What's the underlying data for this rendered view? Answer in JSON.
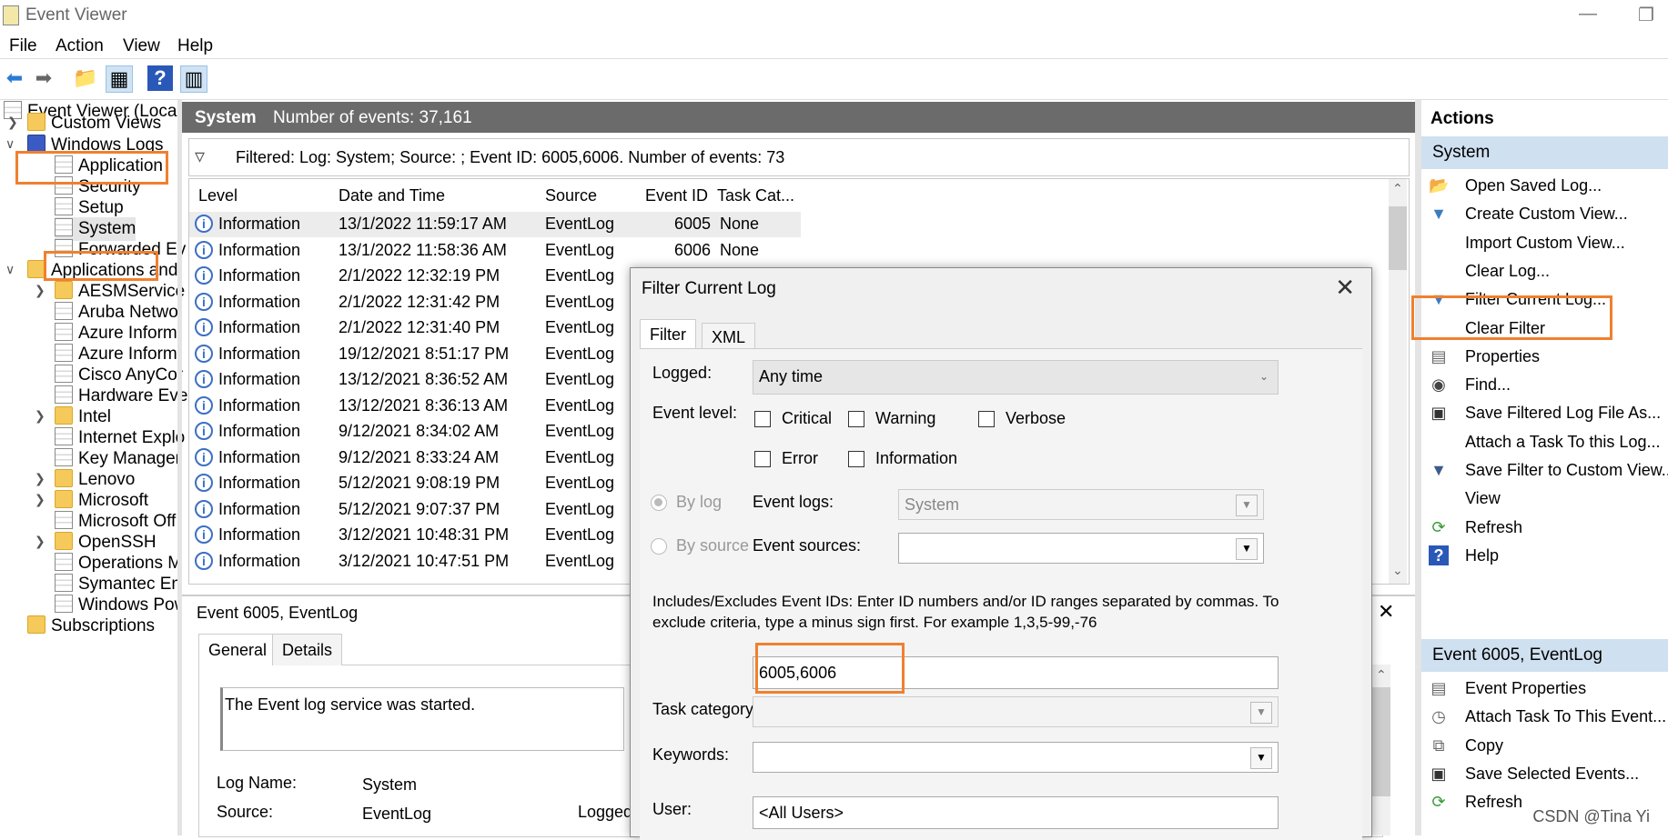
{
  "window": {
    "title": "Event Viewer"
  },
  "menu": [
    "File",
    "Action",
    "View",
    "Help"
  ],
  "toolbar_icons": [
    "back-arrow-icon",
    "forward-arrow-icon",
    "folder-up-icon",
    "console-tree-icon",
    "help-icon",
    "action-pane-icon"
  ],
  "tree": {
    "root": "Event Viewer (Local)",
    "custom_views": "Custom Views",
    "windows_logs": "Windows Logs",
    "win_children": [
      "Application",
      "Security",
      "Setup",
      "System",
      "Forwarded Ev"
    ],
    "apps_services": "Applications and",
    "app_children": [
      "AESMService",
      "Aruba Netwo",
      "Azure Inform",
      "Azure Inform",
      "Cisco AnyCor",
      "Hardware Eve",
      "Intel",
      "Internet Explo",
      "Key Manager",
      "Lenovo",
      "Microsoft",
      "Microsoft Off",
      "OpenSSH",
      "Operations M",
      "Symantec En",
      "Windows Pow"
    ],
    "subscriptions": "Subscriptions"
  },
  "log_header": {
    "name": "System",
    "count_label": "Number of events: 37,161"
  },
  "filter_bar": {
    "text": "Filtered: Log: System; Source: ; Event ID: 6005,6006. Number of events: 73"
  },
  "table": {
    "columns": [
      "Level",
      "Date and Time",
      "Source",
      "Event ID",
      "Task Cat..."
    ],
    "rows": [
      {
        "level": "Information",
        "date": "13/1/2022 11:59:17 AM",
        "source": "EventLog",
        "id": "6005",
        "task": "None"
      },
      {
        "level": "Information",
        "date": "13/1/2022 11:58:36 AM",
        "source": "EventLog",
        "id": "6006",
        "task": "None"
      },
      {
        "level": "Information",
        "date": "2/1/2022 12:32:19 PM",
        "source": "EventLog",
        "id": "",
        "task": ""
      },
      {
        "level": "Information",
        "date": "2/1/2022 12:31:42 PM",
        "source": "EventLog",
        "id": "",
        "task": ""
      },
      {
        "level": "Information",
        "date": "2/1/2022 12:31:40 PM",
        "source": "EventLog",
        "id": "",
        "task": ""
      },
      {
        "level": "Information",
        "date": "19/12/2021 8:51:17 PM",
        "source": "EventLog",
        "id": "",
        "task": ""
      },
      {
        "level": "Information",
        "date": "13/12/2021 8:36:52 AM",
        "source": "EventLog",
        "id": "",
        "task": ""
      },
      {
        "level": "Information",
        "date": "13/12/2021 8:36:13 AM",
        "source": "EventLog",
        "id": "",
        "task": ""
      },
      {
        "level": "Information",
        "date": "9/12/2021 8:34:02 AM",
        "source": "EventLog",
        "id": "",
        "task": ""
      },
      {
        "level": "Information",
        "date": "9/12/2021 8:33:24 AM",
        "source": "EventLog",
        "id": "",
        "task": ""
      },
      {
        "level": "Information",
        "date": "5/12/2021 9:08:19 PM",
        "source": "EventLog",
        "id": "",
        "task": ""
      },
      {
        "level": "Information",
        "date": "5/12/2021 9:07:37 PM",
        "source": "EventLog",
        "id": "",
        "task": ""
      },
      {
        "level": "Information",
        "date": "3/12/2021 10:48:31 PM",
        "source": "EventLog",
        "id": "",
        "task": ""
      },
      {
        "level": "Information",
        "date": "3/12/2021 10:47:51 PM",
        "source": "EventLog",
        "id": "",
        "task": ""
      }
    ]
  },
  "detail": {
    "header": "Event 6005, EventLog",
    "tabs": [
      "General",
      "Details"
    ],
    "description": "The Event log service was started.",
    "log_name_label": "Log Name:",
    "log_name_value": "System",
    "source_label": "Source:",
    "source_value": "EventLog",
    "logged_label": "Logged"
  },
  "actions": {
    "title": "Actions",
    "section1": "System",
    "items1": [
      {
        "icon": "open-folder-icon",
        "label": "Open Saved Log..."
      },
      {
        "icon": "filter-icon",
        "label": "Create Custom View..."
      },
      {
        "icon": "",
        "label": "Import Custom View..."
      },
      {
        "icon": "",
        "label": "Clear Log..."
      },
      {
        "icon": "filter-icon",
        "label": "Filter Current Log..."
      },
      {
        "icon": "",
        "label": "Clear Filter"
      },
      {
        "icon": "properties-icon",
        "label": "Properties"
      },
      {
        "icon": "binoculars-icon",
        "label": "Find..."
      },
      {
        "icon": "save-icon",
        "label": "Save Filtered Log File As..."
      },
      {
        "icon": "",
        "label": "Attach a Task To this Log..."
      },
      {
        "icon": "filter-save-icon",
        "label": "Save Filter to Custom View..."
      },
      {
        "icon": "",
        "label": "View"
      },
      {
        "icon": "refresh-icon",
        "label": "Refresh"
      },
      {
        "icon": "help-icon",
        "label": "Help"
      }
    ],
    "section2": "Event 6005, EventLog",
    "items2": [
      {
        "icon": "properties-icon",
        "label": "Event Properties"
      },
      {
        "icon": "task-icon",
        "label": "Attach Task To This Event..."
      },
      {
        "icon": "copy-icon",
        "label": "Copy"
      },
      {
        "icon": "save-icon",
        "label": "Save Selected Events..."
      },
      {
        "icon": "refresh-icon",
        "label": "Refresh"
      }
    ]
  },
  "dialog": {
    "title": "Filter Current Log",
    "tabs": [
      "Filter",
      "XML"
    ],
    "logged_label": "Logged:",
    "logged_value": "Any time",
    "event_level_label": "Event level:",
    "levels": [
      "Critical",
      "Warning",
      "Verbose",
      "Error",
      "Information"
    ],
    "by_log": "By log",
    "by_source": "By source",
    "event_logs_label": "Event logs:",
    "event_logs_value": "System",
    "event_sources_label": "Event sources:",
    "includes_text": "Includes/Excludes Event IDs: Enter ID numbers and/or ID ranges separated by commas. To exclude criteria, type a minus sign first. For example 1,3,5-99,-76",
    "event_ids_value": "6005,6006",
    "task_category_label": "Task category:",
    "keywords_label": "Keywords:",
    "user_label": "User:",
    "user_value": "<All Users>"
  },
  "watermark": "CSDN @Tina Yi",
  "colors": {
    "highlight": "#f0802f",
    "header_gray": "#6b6b6b",
    "section_blue": "#cfe0f0",
    "info_blue": "#3b6fc4"
  }
}
